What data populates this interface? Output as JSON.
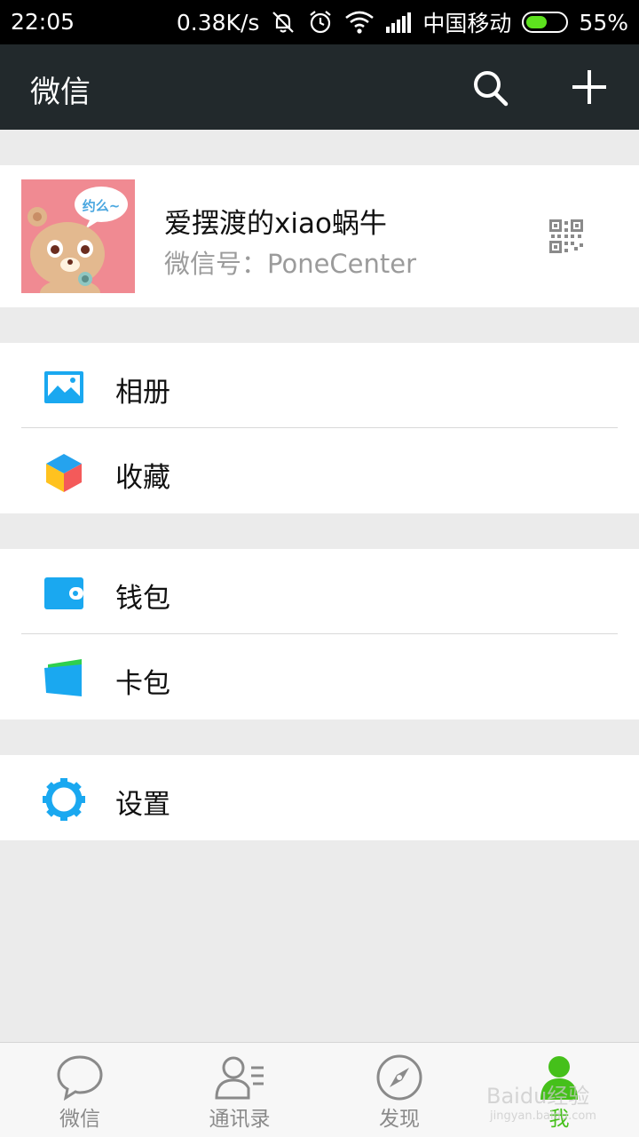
{
  "status_bar": {
    "time": "22:05",
    "net_speed": "0.38K/s",
    "carrier": "中国移动",
    "battery": "55%",
    "battery_level": 0.55
  },
  "app_bar": {
    "title": "微信"
  },
  "profile": {
    "name": "爱摆渡的xiao蜗牛",
    "wechat_id": "微信号：PoneCenter",
    "avatar_text": "约么~"
  },
  "menu": {
    "album": "相册",
    "favorites": "收藏",
    "wallet": "钱包",
    "card_pack": "卡包",
    "settings": "设置"
  },
  "tabs": [
    {
      "label": "微信"
    },
    {
      "label": "通讯录"
    },
    {
      "label": "发现"
    },
    {
      "label": "我"
    }
  ],
  "watermark": {
    "brand": "Baidu经验",
    "url": "jingyan.baidu.com"
  },
  "colors": {
    "accent": "#45c01a",
    "icon_blue": "#1aa8f0",
    "appbar": "#22292c"
  }
}
